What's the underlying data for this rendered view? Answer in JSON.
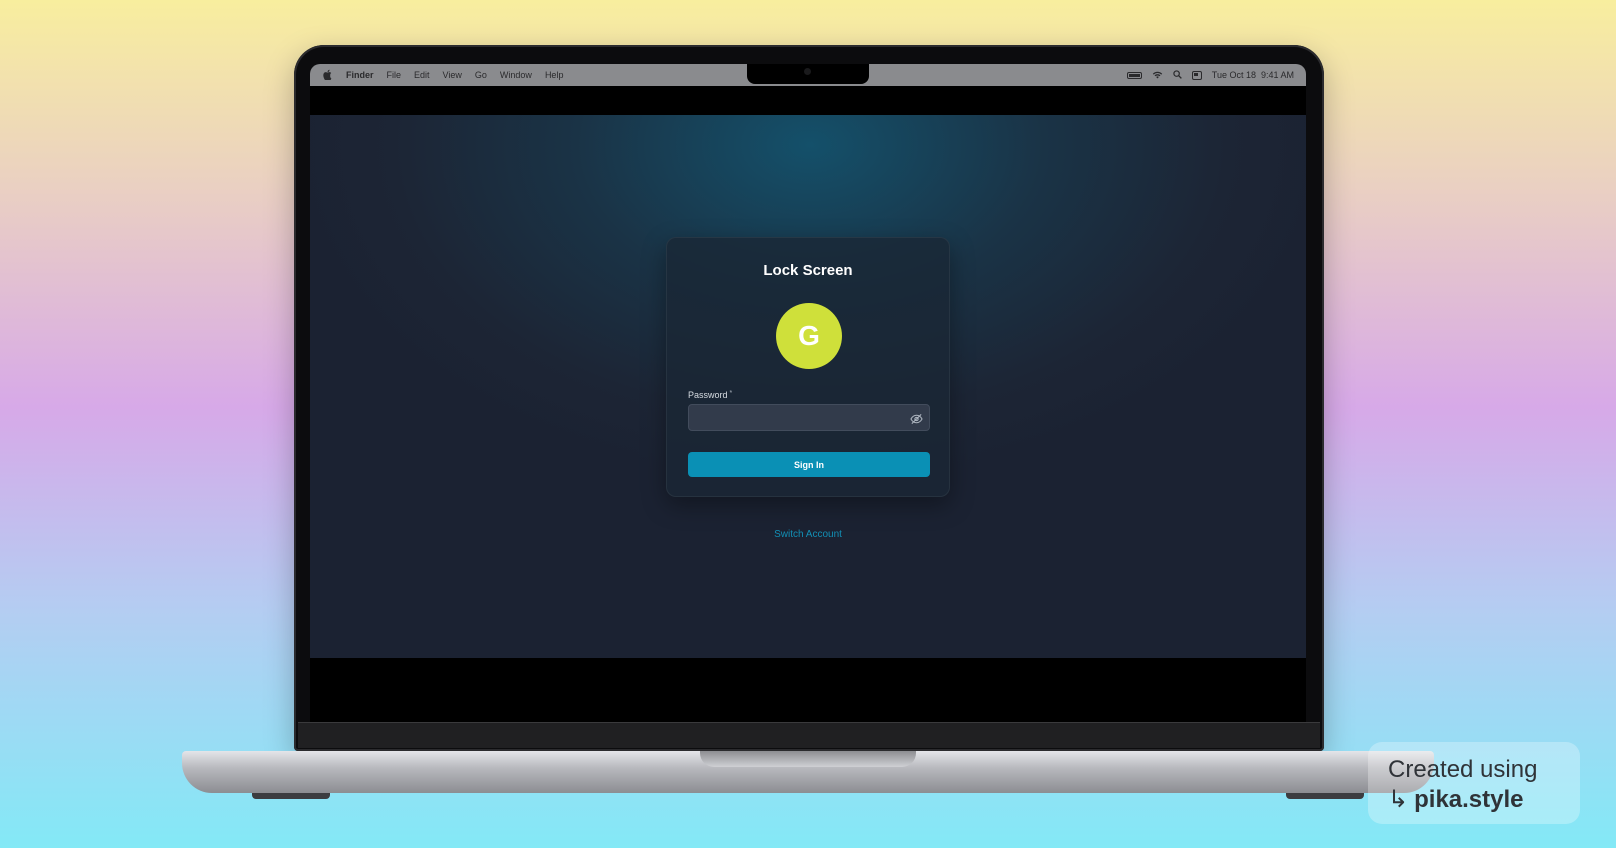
{
  "menubar": {
    "apple_icon": "apple-icon",
    "app_name": "Finder",
    "menus": [
      "File",
      "Edit",
      "View",
      "Go",
      "Window",
      "Help"
    ],
    "status_icons": [
      "battery-icon",
      "wifi-icon",
      "search-icon",
      "control-center-icon"
    ],
    "datetime": "Tue Oct 18  9:41 AM"
  },
  "lock_screen": {
    "title": "Lock Screen",
    "avatar_initial": "G",
    "password_label": "Password",
    "password_required_mark": "*",
    "password_value": "",
    "toggle_visibility_icon": "eye-off-icon",
    "sign_in_label": "Sign In",
    "switch_account_label": "Switch Account"
  },
  "watermark": {
    "line1": "Created using",
    "arrow": "↳",
    "brand": "pika.style"
  },
  "colors": {
    "accent": "#0a90b5",
    "avatar": "#cfe03a",
    "link": "#128fb5"
  }
}
